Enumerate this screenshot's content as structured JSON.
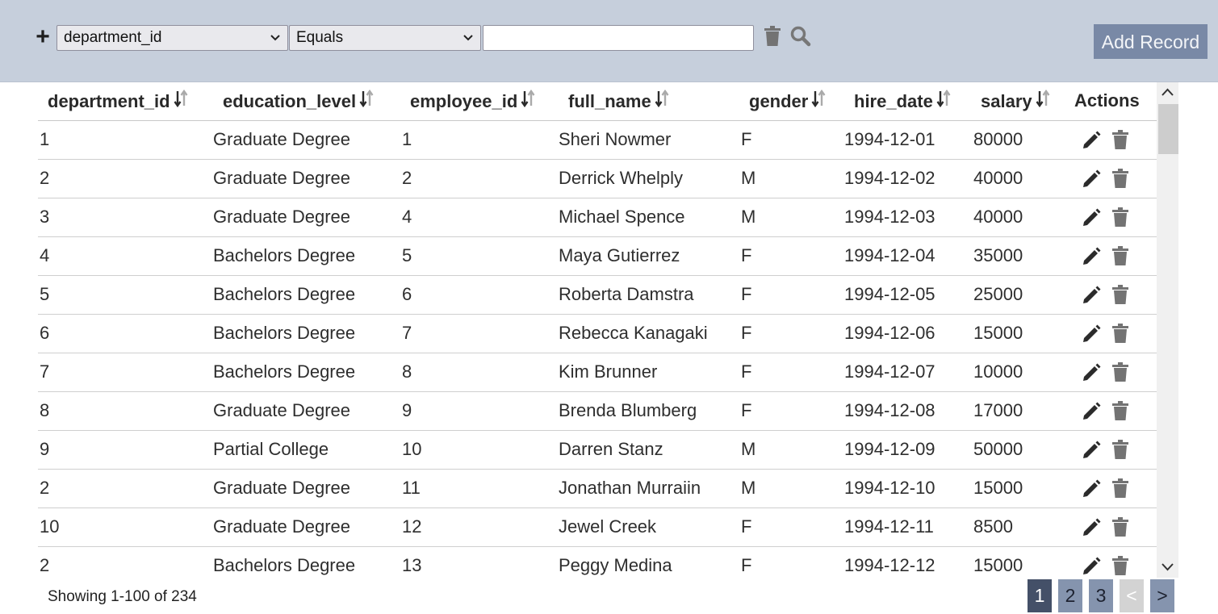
{
  "toolbar": {
    "add_filter_symbol": "+",
    "field_select": "department_id",
    "operator_select": "Equals",
    "filter_value": "",
    "add_record_label": "Add Record"
  },
  "table": {
    "columns": [
      "department_id",
      "education_level",
      "employee_id",
      "full_name",
      "gender",
      "hire_date",
      "salary",
      "Actions"
    ],
    "rows": [
      [
        "1",
        "Graduate Degree",
        "1",
        "Sheri Nowmer",
        "F",
        "1994-12-01",
        "80000"
      ],
      [
        "2",
        "Graduate Degree",
        "2",
        "Derrick Whelply",
        "M",
        "1994-12-02",
        "40000"
      ],
      [
        "3",
        "Graduate Degree",
        "4",
        "Michael Spence",
        "M",
        "1994-12-03",
        "40000"
      ],
      [
        "4",
        "Bachelors Degree",
        "5",
        "Maya Gutierrez",
        "F",
        "1994-12-04",
        "35000"
      ],
      [
        "5",
        "Bachelors Degree",
        "6",
        "Roberta Damstra",
        "F",
        "1994-12-05",
        "25000"
      ],
      [
        "6",
        "Bachelors Degree",
        "7",
        "Rebecca Kanagaki",
        "F",
        "1994-12-06",
        "15000"
      ],
      [
        "7",
        "Bachelors Degree",
        "8",
        "Kim Brunner",
        "F",
        "1994-12-07",
        "10000"
      ],
      [
        "8",
        "Graduate Degree",
        "9",
        "Brenda Blumberg",
        "F",
        "1994-12-08",
        "17000"
      ],
      [
        "9",
        "Partial College",
        "10",
        "Darren Stanz",
        "M",
        "1994-12-09",
        "50000"
      ],
      [
        "2",
        "Graduate Degree",
        "11",
        "Jonathan Murraiin",
        "M",
        "1994-12-10",
        "15000"
      ],
      [
        "10",
        "Graduate Degree",
        "12",
        "Jewel Creek",
        "F",
        "1994-12-11",
        "8500"
      ],
      [
        "2",
        "Bachelors Degree",
        "13",
        "Peggy Medina",
        "F",
        "1994-12-12",
        "15000"
      ]
    ]
  },
  "footer": {
    "showing": "Showing 1-100 of 234",
    "pages": [
      "1",
      "2",
      "3"
    ],
    "current_page": "1",
    "prev_label": "<",
    "next_label": ">"
  },
  "colors": {
    "toolbar_bg": "#c6cfdc",
    "accent": "#7989a6",
    "page_active": "#445068",
    "page_normal": "#8594ae"
  },
  "icons": {
    "add_filter": "plus-icon",
    "clear_filter": "trash-icon",
    "search": "search-icon",
    "sort": "sort-arrows-icon",
    "edit": "pencil-icon",
    "delete": "trash-icon"
  }
}
